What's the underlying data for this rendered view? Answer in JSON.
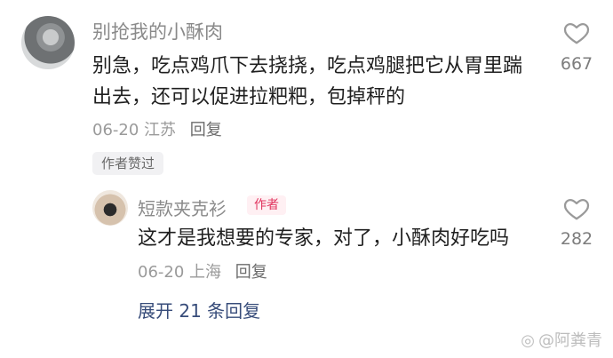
{
  "main_comment": {
    "username": "别抢我的小酥肉",
    "content": "别急，吃点鸡爪下去挠挠，吃点鸡腿把它从胃里踹出去，还可以促进拉粑粑，包掉秤的",
    "date": "06-20",
    "location": "江苏",
    "reply_label": "回复",
    "likes": "667",
    "author_liked_label": "作者赞过"
  },
  "reply": {
    "username": "短款夹克衫",
    "author_badge": "作者",
    "content": "这才是我想要的专家，对了，小酥肉好吃吗",
    "date": "06-20",
    "location": "上海",
    "reply_label": "回复",
    "likes": "282"
  },
  "expand": {
    "label": "展开 21 条回复"
  },
  "watermark": {
    "symbol": "◎",
    "text": "@阿粪青"
  }
}
